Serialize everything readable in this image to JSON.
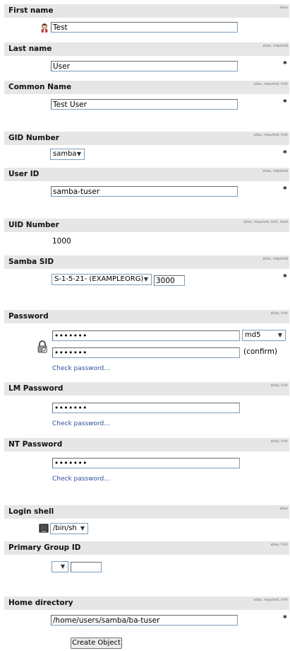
{
  "first_name": {
    "label": "First name",
    "hint": "alias",
    "value": "Test"
  },
  "last_name": {
    "label": "Last name",
    "hint": "alias, required",
    "value": "User"
  },
  "common_name": {
    "label": "Common Name",
    "hint": "alias, required, hint",
    "value": "Test User"
  },
  "gid_number": {
    "label": "GID Number",
    "hint": "alias, required, hint",
    "value": "samba"
  },
  "user_id": {
    "label": "User ID",
    "hint": "alias, required",
    "value": "samba-tuser"
  },
  "uid_number": {
    "label": "UID Number",
    "hint": "alias, required, hint, read",
    "value": "1000"
  },
  "samba_sid": {
    "label": "Samba SID",
    "hint": "alias, required",
    "domain": "S-1-5-21- (EXAMPLEORG)",
    "rid": "3000"
  },
  "password": {
    "label": "Password",
    "hint": "alias, hint",
    "value": "•••••••",
    "confirm_value": "•••••••",
    "hash": "md5",
    "confirm_label": "(confirm)",
    "check_link": "Check password..."
  },
  "lm_password": {
    "label": "LM Password",
    "hint": "alias, hint",
    "value": "•••••••",
    "check_link": "Check password..."
  },
  "nt_password": {
    "label": "NT Password",
    "hint": "alias, hint",
    "value": "•••••••",
    "check_link": "Check password..."
  },
  "login_shell": {
    "label": "Login shell",
    "hint": "alias",
    "value": "/bin/sh"
  },
  "primary_group_id": {
    "label": "Primary Group ID",
    "hint": "alias, hint",
    "select_value": "",
    "input_value": ""
  },
  "home_directory": {
    "label": "Home directory",
    "hint": "alias, required, hint",
    "value": "/home/users/samba/ba-tuser"
  },
  "required_mark": "*",
  "submit_label": "Create Object"
}
